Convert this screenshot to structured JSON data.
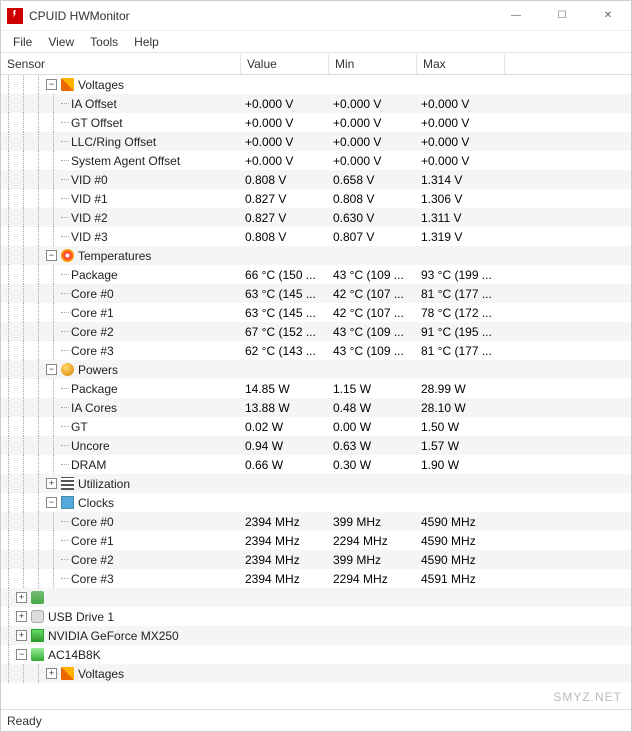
{
  "window": {
    "title": "CPUID HWMonitor",
    "min": "—",
    "max": "☐",
    "close": "✕"
  },
  "menu": {
    "file": "File",
    "view": "View",
    "tools": "Tools",
    "help": "Help"
  },
  "headers": {
    "sensor": "Sensor",
    "value": "Value",
    "min": "Min",
    "max": "Max"
  },
  "groups": {
    "voltages": "Voltages",
    "temperatures": "Temperatures",
    "powers": "Powers",
    "utilization": "Utilization",
    "clocks": "Clocks"
  },
  "voltages": [
    {
      "label": "IA Offset",
      "value": "+0.000 V",
      "min": "+0.000 V",
      "max": "+0.000 V"
    },
    {
      "label": "GT Offset",
      "value": "+0.000 V",
      "min": "+0.000 V",
      "max": "+0.000 V"
    },
    {
      "label": "LLC/Ring Offset",
      "value": "+0.000 V",
      "min": "+0.000 V",
      "max": "+0.000 V"
    },
    {
      "label": "System Agent Offset",
      "value": "+0.000 V",
      "min": "+0.000 V",
      "max": "+0.000 V"
    },
    {
      "label": "VID #0",
      "value": "0.808 V",
      "min": "0.658 V",
      "max": "1.314 V"
    },
    {
      "label": "VID #1",
      "value": "0.827 V",
      "min": "0.808 V",
      "max": "1.306 V"
    },
    {
      "label": "VID #2",
      "value": "0.827 V",
      "min": "0.630 V",
      "max": "1.311 V"
    },
    {
      "label": "VID #3",
      "value": "0.808 V",
      "min": "0.807 V",
      "max": "1.319 V"
    }
  ],
  "temperatures": [
    {
      "label": "Package",
      "value": "66 °C  (150 ...",
      "min": "43 °C  (109 ...",
      "max": "93 °C  (199 ..."
    },
    {
      "label": "Core #0",
      "value": "63 °C  (145 ...",
      "min": "42 °C  (107 ...",
      "max": "81 °C  (177 ..."
    },
    {
      "label": "Core #1",
      "value": "63 °C  (145 ...",
      "min": "42 °C  (107 ...",
      "max": "78 °C  (172 ..."
    },
    {
      "label": "Core #2",
      "value": "67 °C  (152 ...",
      "min": "43 °C  (109 ...",
      "max": "91 °C  (195 ..."
    },
    {
      "label": "Core #3",
      "value": "62 °C  (143 ...",
      "min": "43 °C  (109 ...",
      "max": "81 °C  (177 ..."
    }
  ],
  "powers": [
    {
      "label": "Package",
      "value": "14.85 W",
      "min": "1.15 W",
      "max": "28.99 W"
    },
    {
      "label": "IA Cores",
      "value": "13.88 W",
      "min": "0.48 W",
      "max": "28.10 W"
    },
    {
      "label": "GT",
      "value": "0.02 W",
      "min": "0.00 W",
      "max": "1.50 W"
    },
    {
      "label": "Uncore",
      "value": "0.94 W",
      "min": "0.63 W",
      "max": "1.57 W"
    },
    {
      "label": "DRAM",
      "value": "0.66 W",
      "min": "0.30 W",
      "max": "1.90 W"
    }
  ],
  "clocks": [
    {
      "label": "Core #0",
      "value": "2394 MHz",
      "min": "399 MHz",
      "max": "4590 MHz"
    },
    {
      "label": "Core #1",
      "value": "2394 MHz",
      "min": "2294 MHz",
      "max": "4590 MHz"
    },
    {
      "label": "Core #2",
      "value": "2394 MHz",
      "min": "399 MHz",
      "max": "4590 MHz"
    },
    {
      "label": "Core #3",
      "value": "2394 MHz",
      "min": "2294 MHz",
      "max": "4591 MHz"
    }
  ],
  "devices": {
    "unknown": "",
    "usb": "USB Drive 1",
    "gpu": "NVIDIA GeForce MX250",
    "battery": "AC14B8K"
  },
  "status": "Ready",
  "watermark": "SMYZ.NET",
  "toggle": {
    "plus": "+",
    "minus": "−"
  }
}
